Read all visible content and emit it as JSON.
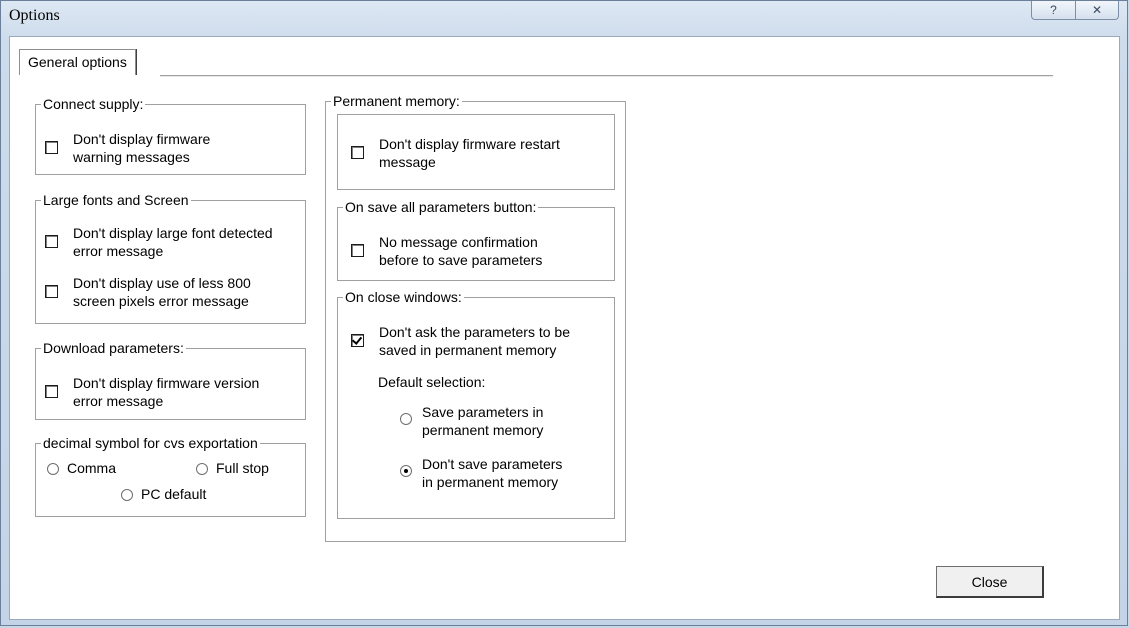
{
  "window": {
    "title": "Options",
    "help_glyph": "?",
    "close_glyph": "✕"
  },
  "tab": {
    "label": "General options"
  },
  "connect_supply": {
    "legend": "Connect supply:",
    "option": {
      "line1": "Don't display firmware",
      "line2": "warning messages",
      "checked": false
    }
  },
  "large_fonts": {
    "legend": "Large fonts and Screen",
    "options": [
      {
        "line1": "Don't display large font detected",
        "line2": "error message",
        "checked": false
      },
      {
        "line1": "Don't display use of less 800",
        "line2": "screen pixels error message",
        "checked": false
      }
    ]
  },
  "download_params": {
    "legend": "Download parameters:",
    "option": {
      "line1": "Don't display firmware version",
      "line2": "error message",
      "checked": false
    }
  },
  "decimal_symbol": {
    "legend": "decimal symbol for cvs exportation",
    "options": [
      {
        "label": "Comma",
        "selected": false
      },
      {
        "label": "Full stop",
        "selected": false
      },
      {
        "label": "PC default",
        "selected": false
      }
    ]
  },
  "permanent_memory": {
    "legend": "Permanent memory:",
    "option": {
      "line1": "Don't display firmware restart",
      "line2": "message",
      "checked": false
    }
  },
  "save_all": {
    "legend": "On save all parameters button:",
    "option": {
      "line1": "No message confirmation",
      "line2": "before to save parameters",
      "checked": false
    }
  },
  "close_windows": {
    "legend": "On close windows:",
    "option": {
      "line1": "Don't ask the parameters to be",
      "line2": "saved in permanent memory",
      "checked": true
    },
    "default_label": "Default selection:",
    "radios": [
      {
        "line1": "Save parameters in",
        "line2": "permanent memory",
        "selected": false
      },
      {
        "line1": "Don't save parameters",
        "line2": "in permanent memory",
        "selected": true
      }
    ]
  },
  "buttons": {
    "close_label": "Close"
  }
}
